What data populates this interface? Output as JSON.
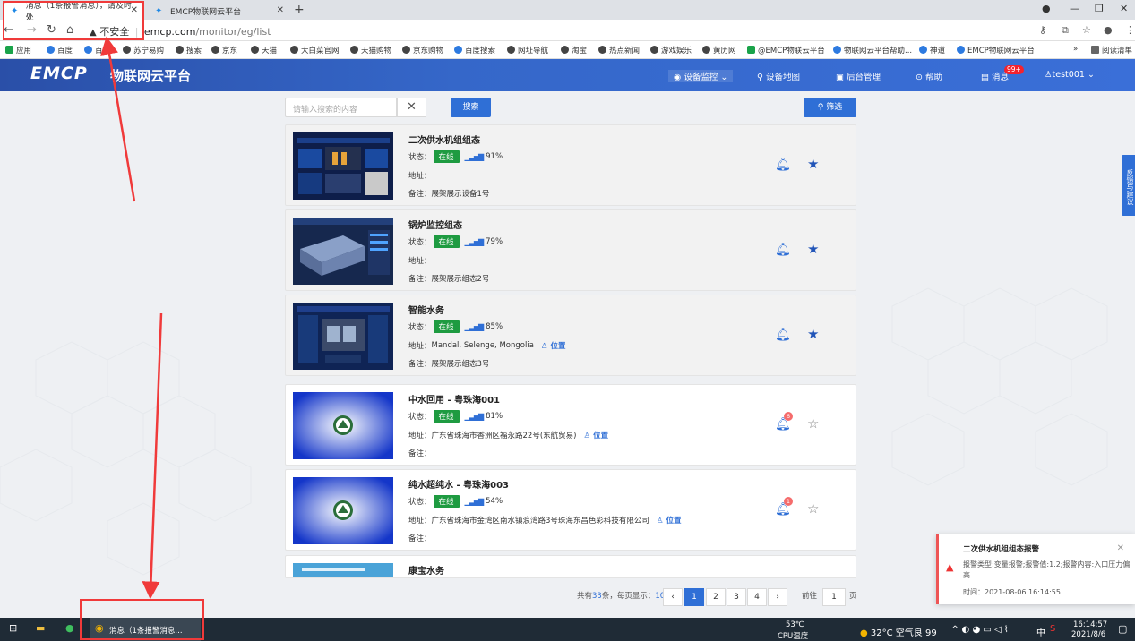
{
  "browser": {
    "tabs": [
      {
        "title": "消息（1条报警消息），请及时处",
        "active": true
      },
      {
        "title": "EMCP物联网云平台",
        "active": false
      }
    ],
    "address": {
      "security": "不安全",
      "host": "emcp.com",
      "path": "/monitor/eg/list"
    },
    "bookmarks": [
      "应用",
      "百度",
      "百度",
      "苏宁易购",
      "搜索",
      "京东",
      "天猫",
      "大白菜官网",
      "天猫购物",
      "京东购物",
      "百度搜索",
      "网址导航",
      "淘宝",
      "热点新闻",
      "游戏娱乐",
      "黄历网",
      "@EMCP物联云平台",
      "物联网云平台帮助...",
      "神道",
      "EMCP物联网云平台",
      "阅读清单"
    ]
  },
  "header": {
    "logo": "EMCP",
    "subtitle": "物联网云平台",
    "nav": {
      "monitor": "设备监控",
      "map": "设备地图",
      "admin": "后台管理",
      "help": "帮助",
      "messages": "消息",
      "messages_badge": "99+",
      "user": "test001"
    }
  },
  "search": {
    "placeholder": "请输入搜索的内容",
    "clear": "✕",
    "button": "搜索",
    "filter": "筛选"
  },
  "labels": {
    "status": "状态：",
    "address": "地址：",
    "note": "备注：",
    "online": "在线",
    "location": "位置"
  },
  "devices": [
    {
      "name": "二次供水机组组态",
      "signal": "91%",
      "address": "",
      "note": "展架展示设备1号",
      "starred": true
    },
    {
      "name": "锅炉监控组态",
      "signal": "79%",
      "address": "",
      "note": "展架展示组态2号",
      "starred": true
    },
    {
      "name": "智能水务",
      "signal": "85%",
      "address": "Mandal, Selenge, Mongolia",
      "note": "展架展示组态3号",
      "starred": true
    },
    {
      "name": "中水回用 - 粤珠海001",
      "signal": "81%",
      "address": "广东省珠海市香洲区福永路22号(东航贸易)",
      "note": "",
      "starred": false,
      "alarms": "6"
    },
    {
      "name": "纯水超纯水 - 粤珠海003",
      "signal": "54%",
      "address": "广东省珠海市金湾区南水镇浪湾路3号珠海东昌色彩科技有限公司",
      "note": "",
      "starred": false,
      "alarms": "1"
    },
    {
      "name": "康宝水务"
    }
  ],
  "pagination": {
    "total_prefix": "共有",
    "total": "33",
    "total_suffix": "条，每页显示：",
    "per_page": "10条",
    "pages": [
      "1",
      "2",
      "3",
      "4"
    ],
    "goto_label": "前往",
    "goto_value": "1",
    "goto_suffix": "页"
  },
  "feedback": "反馈与建议",
  "notification": {
    "title": "二次供水机组组态报警",
    "body": "报警类型:变量报警;报警值:1.2;报警内容:入口压力偏高",
    "time": "时间：2021-08-06 16:14:55"
  },
  "taskbar": {
    "active_app": "消息（1条报警消息...",
    "cpu_temp": "53℃",
    "cpu_label": "CPU温度",
    "weather": "32°C 空气良 99",
    "ime": "中",
    "time": "16:14:57",
    "date": "2021/8/6"
  },
  "colors": {
    "brand": "#2f6fd6",
    "online": "#1e9b41",
    "annotation": "#f03a3a"
  }
}
